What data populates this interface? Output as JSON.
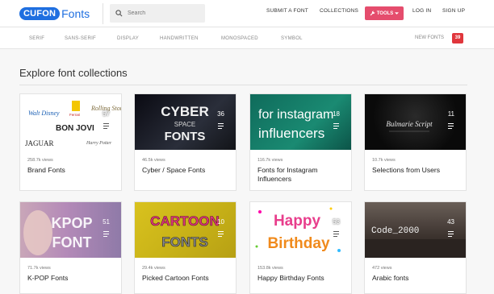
{
  "brand": {
    "logo_box": "CUFON",
    "logo_text": "Fonts"
  },
  "search": {
    "placeholder": "Search"
  },
  "nav": {
    "submit": "SUBMIT A FONT",
    "collections": "COLLECTIONS",
    "tools": "TOOLS",
    "login": "LOG IN",
    "signup": "SIGN UP"
  },
  "categories": [
    "SERIF",
    "SANS-SERIF",
    "DISPLAY",
    "HANDWRITTEN",
    "MONOSPACED",
    "SYMBOL"
  ],
  "new_fonts": {
    "label": "NEW FONTS",
    "count": "39"
  },
  "heading": "Explore font collections",
  "cards": [
    {
      "views": "258.7k views",
      "title": "Brand Fonts",
      "count": "57",
      "thumb": [
        "BON JOVI",
        "JAGUAR",
        "Walt Disney",
        "Ferrari",
        "Rolling Stones",
        "Harry Potter"
      ]
    },
    {
      "views": "46.5k views",
      "title": "Cyber / Space Fonts",
      "count": "36",
      "thumb": [
        "CYBER",
        "SPACE",
        "FONTS"
      ]
    },
    {
      "views": "116.7k views",
      "title": "Fonts for Instagram Influencers",
      "count": "18",
      "thumb": [
        "for instagram",
        "influencers"
      ]
    },
    {
      "views": "10.7k views",
      "title": "Selections from Users",
      "count": "11",
      "thumb": [
        "Bulmarie Script"
      ]
    },
    {
      "views": "71.7k views",
      "title": "K-POP Fonts",
      "count": "51",
      "thumb": [
        "KPOP",
        "FONT"
      ]
    },
    {
      "views": "29.4k views",
      "title": "Picked Cartoon Fonts",
      "count": "10",
      "thumb": [
        "CARTOON",
        "FONTS"
      ]
    },
    {
      "views": "153.8k views",
      "title": "Happy Birthday Fonts",
      "count": "53",
      "thumb": [
        "Happy",
        "Birthday"
      ]
    },
    {
      "views": "472 views",
      "title": "Arabic fonts",
      "count": "43",
      "thumb": [
        "Code_2000"
      ]
    }
  ],
  "colors": {
    "brand": "#1f6fe0",
    "tools": "#e54d6d",
    "badge": "#e0363c"
  },
  "icons": [
    "search-icon",
    "wrench-icon",
    "chevron-down-icon",
    "list-icon"
  ]
}
